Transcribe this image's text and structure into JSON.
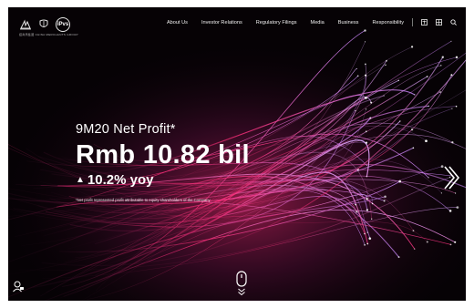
{
  "header": {
    "logo_sub": "招商局集团 CHINA MERCHANTS GROUP",
    "ipvs_logo": "iPvs",
    "nav": [
      "About Us",
      "Investor Relations",
      "Regulatory Filings",
      "Media",
      "Business",
      "Responsibility"
    ],
    "icons": [
      "language-icon",
      "menu-grid-icon",
      "search-icon"
    ]
  },
  "hero": {
    "kicker": "9M20 Net Profit*",
    "figure": "Rmb 10.82 bil",
    "growth": "10.2% yoy",
    "growth_arrow": "▲",
    "note": "*Net profit represented profit attributable to equity shareholders of the Company"
  },
  "colors": {
    "background": "#060205",
    "accent_magenta": "#ff2f9a",
    "accent_purple": "#b45cff",
    "text": "#ffffff"
  }
}
